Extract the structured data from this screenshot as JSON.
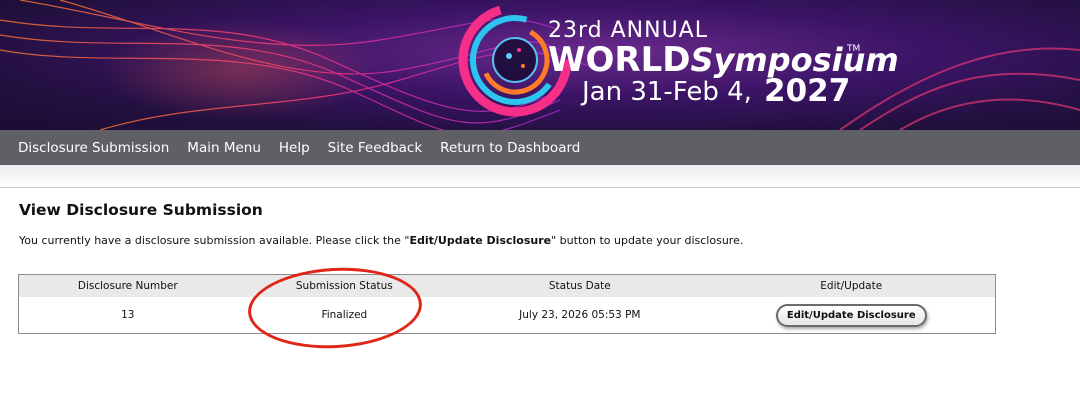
{
  "banner": {
    "edition": "23rd ANNUAL",
    "brand_bold": "WORLD",
    "brand_italic": "Symposium",
    "trademark": "TM",
    "dates": "Jan 31-Feb 4,",
    "year": "2027"
  },
  "nav": {
    "items": [
      {
        "label": "Disclosure Submission"
      },
      {
        "label": "Main Menu"
      },
      {
        "label": "Help"
      },
      {
        "label": "Site Feedback"
      },
      {
        "label": "Return to Dashboard"
      }
    ]
  },
  "page": {
    "title": "View Disclosure Submission",
    "intro_before": "You currently have a disclosure submission available. Please click the \"",
    "intro_bold": "Edit/Update Disclosure",
    "intro_after": "\" button to update your disclosure."
  },
  "table": {
    "headers": [
      "Disclosure Number",
      "Submission Status",
      "Status Date",
      "Edit/Update"
    ],
    "rows": [
      {
        "number": "13",
        "status": "Finalized",
        "date": "July 23, 2026 05:53 PM",
        "action_label": "Edit/Update Disclosure"
      }
    ]
  },
  "colors": {
    "nav_bg": "#5f5f66",
    "highlight": "#e02618",
    "banner_bg": "#3b1466"
  }
}
